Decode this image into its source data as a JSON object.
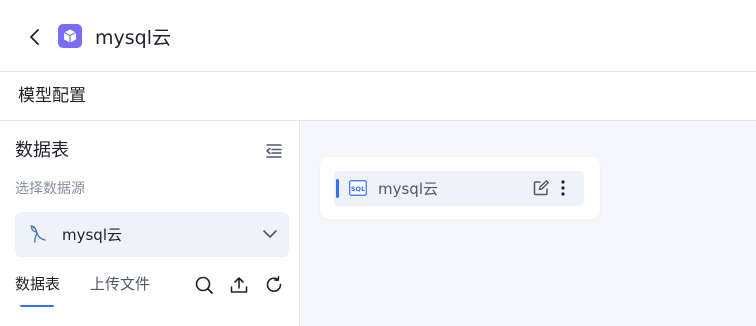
{
  "header": {
    "title": "mysql云",
    "back_icon": "chevron-left-icon",
    "logo_icon": "cube-icon",
    "logo_color": "#7b6cf6"
  },
  "subheader": {
    "title": "模型配置"
  },
  "sidebar": {
    "title": "数据表",
    "collapse_icon": "collapse-menu-icon",
    "source_label": "选择数据源",
    "source_select": {
      "value": "mysql云",
      "icon": "mysql-dolphin-icon",
      "dropdown_icon": "chevron-down-icon"
    },
    "tabs": [
      {
        "label": "数据表",
        "active": true
      },
      {
        "label": "上传文件",
        "active": false
      }
    ],
    "tools": [
      "search-icon",
      "upload-icon",
      "refresh-icon"
    ]
  },
  "main": {
    "items": [
      {
        "name": "mysql云",
        "icon": "sql-file-icon",
        "selected": true
      }
    ]
  },
  "colors": {
    "accent": "#3370ff",
    "selection_bg": "#eef2fb",
    "canvas_bg": "#f4f6fb"
  }
}
